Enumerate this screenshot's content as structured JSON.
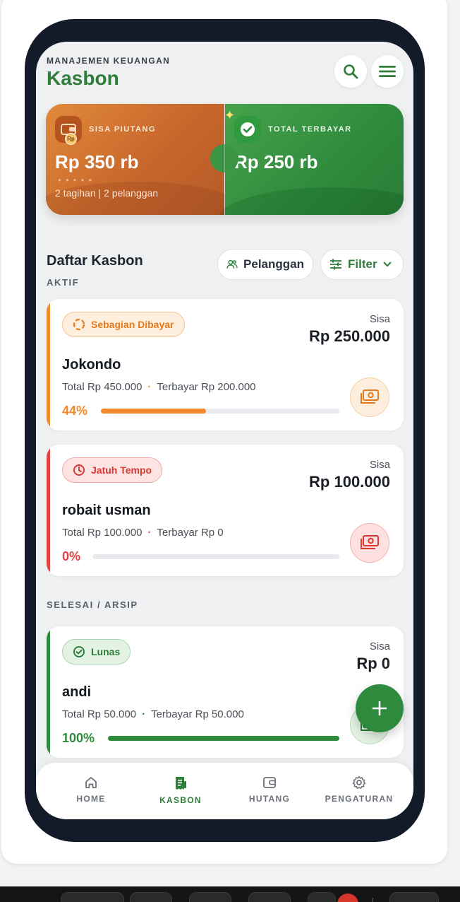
{
  "header": {
    "eyebrow": "MANAJEMEN KEUANGAN",
    "title": "Kasbon"
  },
  "summary": {
    "left": {
      "label": "SISA PIUTANG",
      "value": "Rp 350 rb",
      "sub": "2 tagihan | 2 pelanggan",
      "badge": "Rp"
    },
    "right": {
      "label": "TOTAL TERBAYAR",
      "value": "Rp 250 rb"
    }
  },
  "list": {
    "title": "Daftar Kasbon",
    "active_label": "AKTIF",
    "archive_label": "SELESAI / ARSIP",
    "customers_button": "Pelanggan",
    "filter_button": "Filter"
  },
  "cards": [
    {
      "status": "Sebagian Dibayar",
      "sisa_label": "Sisa",
      "sisa": "Rp 250.000",
      "name": "Jokondo",
      "total": "Total Rp 450.000",
      "paid": "Terbayar Rp 200.000",
      "percent_label": "44%",
      "progress": 0.44,
      "color": "#f08a2c"
    },
    {
      "status": "Jatuh Tempo",
      "sisa_label": "Sisa",
      "sisa": "Rp 100.000",
      "name": "robait usman",
      "total": "Total Rp 100.000",
      "paid": "Terbayar Rp 0",
      "percent_label": "0%",
      "progress": 0.0,
      "color": "#e2433f"
    },
    {
      "status": "Lunas",
      "sisa_label": "Sisa",
      "sisa": "Rp 0",
      "name": "andi",
      "total": "Total Rp 50.000",
      "paid": "Terbayar Rp 50.000",
      "percent_label": "100%",
      "progress": 1.0,
      "color": "#2e8a3c"
    }
  ],
  "fab": {
    "icon": "plus-icon"
  },
  "nav": [
    {
      "label": "HOME",
      "icon": "home-icon"
    },
    {
      "label": "KASBON",
      "icon": "receipt-icon",
      "active": true
    },
    {
      "label": "HUTANG",
      "icon": "wallet-icon"
    },
    {
      "label": "PENGATURAN",
      "icon": "gear-icon"
    }
  ],
  "colors": {
    "brand": "#2e7d3a",
    "frame": "#131a2a",
    "orange": "#f08a2c",
    "red": "#e2433f",
    "green": "#2e8a3c"
  }
}
